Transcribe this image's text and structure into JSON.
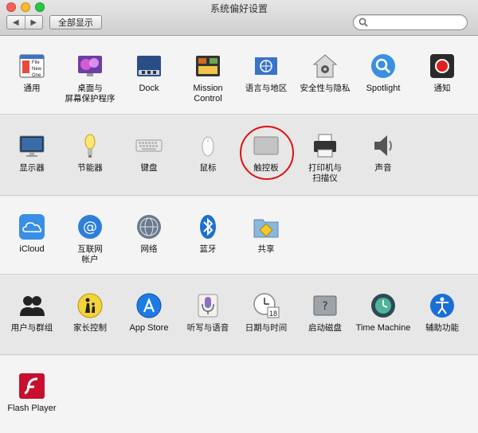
{
  "window": {
    "title": "系统偏好设置"
  },
  "toolbar": {
    "back": "◀",
    "forward": "▶",
    "show_all": "全部显示"
  },
  "search": {
    "placeholder": "",
    "value": ""
  },
  "sections": {
    "personal": [
      {
        "label": "通用"
      },
      {
        "label": "桌面与\n屏幕保护程序"
      },
      {
        "label": "Dock"
      },
      {
        "label": "Mission\nControl"
      },
      {
        "label": "语言与地区"
      },
      {
        "label": "安全性与隐私"
      },
      {
        "label": "Spotlight"
      },
      {
        "label": "通知"
      }
    ],
    "hardware": [
      {
        "label": "显示器"
      },
      {
        "label": "节能器"
      },
      {
        "label": "键盘"
      },
      {
        "label": "鼠标"
      },
      {
        "label": "触控板"
      },
      {
        "label": "打印机与\n扫描仪"
      },
      {
        "label": "声音"
      }
    ],
    "internet": [
      {
        "label": "iCloud"
      },
      {
        "label": "互联网\n帐户"
      },
      {
        "label": "网络"
      },
      {
        "label": "蓝牙"
      },
      {
        "label": "共享"
      }
    ],
    "system": [
      {
        "label": "用户与群组"
      },
      {
        "label": "家长控制"
      },
      {
        "label": "App Store"
      },
      {
        "label": "听写与语音"
      },
      {
        "label": "日期与时间"
      },
      {
        "label": "启动磁盘"
      },
      {
        "label": "Time Machine"
      },
      {
        "label": "辅助功能"
      }
    ],
    "other": [
      {
        "label": "Flash Player"
      }
    ]
  },
  "icon_texts": {
    "general_file": "File",
    "general_new": "New",
    "general_one": "One",
    "calendar_day": "18"
  },
  "annotation": {
    "highlight_color": "#e01010"
  }
}
